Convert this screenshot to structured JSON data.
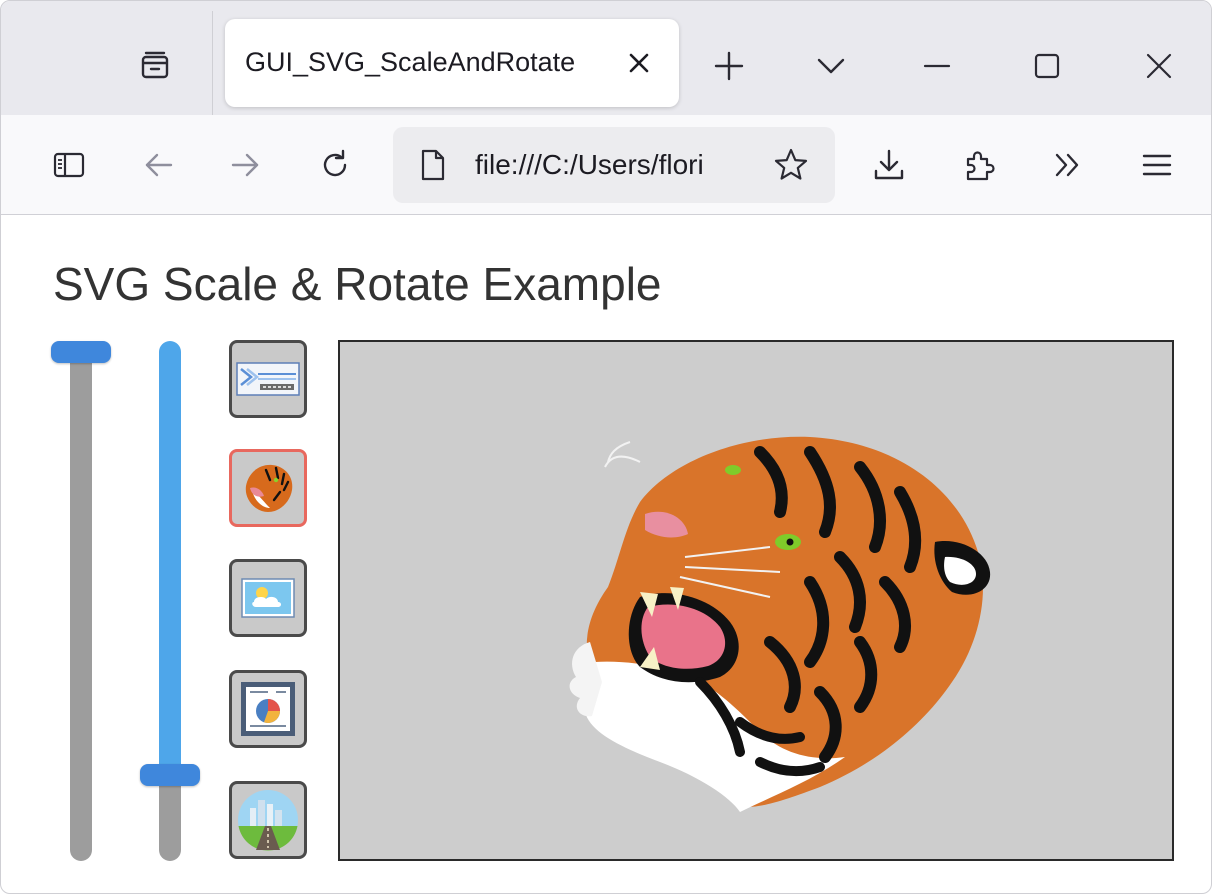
{
  "browser": {
    "tab_title": "GUI_SVG_ScaleAndRotate",
    "url": "file:///C:/Users/flori"
  },
  "page": {
    "title": "SVG Scale & Rotate Example"
  },
  "sliders": [
    {
      "name": "scale",
      "value": 1.0,
      "track_color": "#9d9d9d",
      "handle_color": "#3f87dc"
    },
    {
      "name": "rotate",
      "value": 0.15,
      "track_color": "#4ea6ea",
      "rest_color": "#9d9d9d",
      "handle_color": "#3f87dc"
    }
  ],
  "thumbnails": [
    {
      "icon": "segger-logo-icon",
      "selected": false
    },
    {
      "icon": "tiger-icon",
      "selected": true
    },
    {
      "icon": "landscape-icon",
      "selected": false
    },
    {
      "icon": "pie-chart-document-icon",
      "selected": false
    },
    {
      "icon": "city-road-icon",
      "selected": false
    }
  ],
  "colors": {
    "selection": "#e8685e",
    "canvas_bg": "#cdcdcd"
  }
}
